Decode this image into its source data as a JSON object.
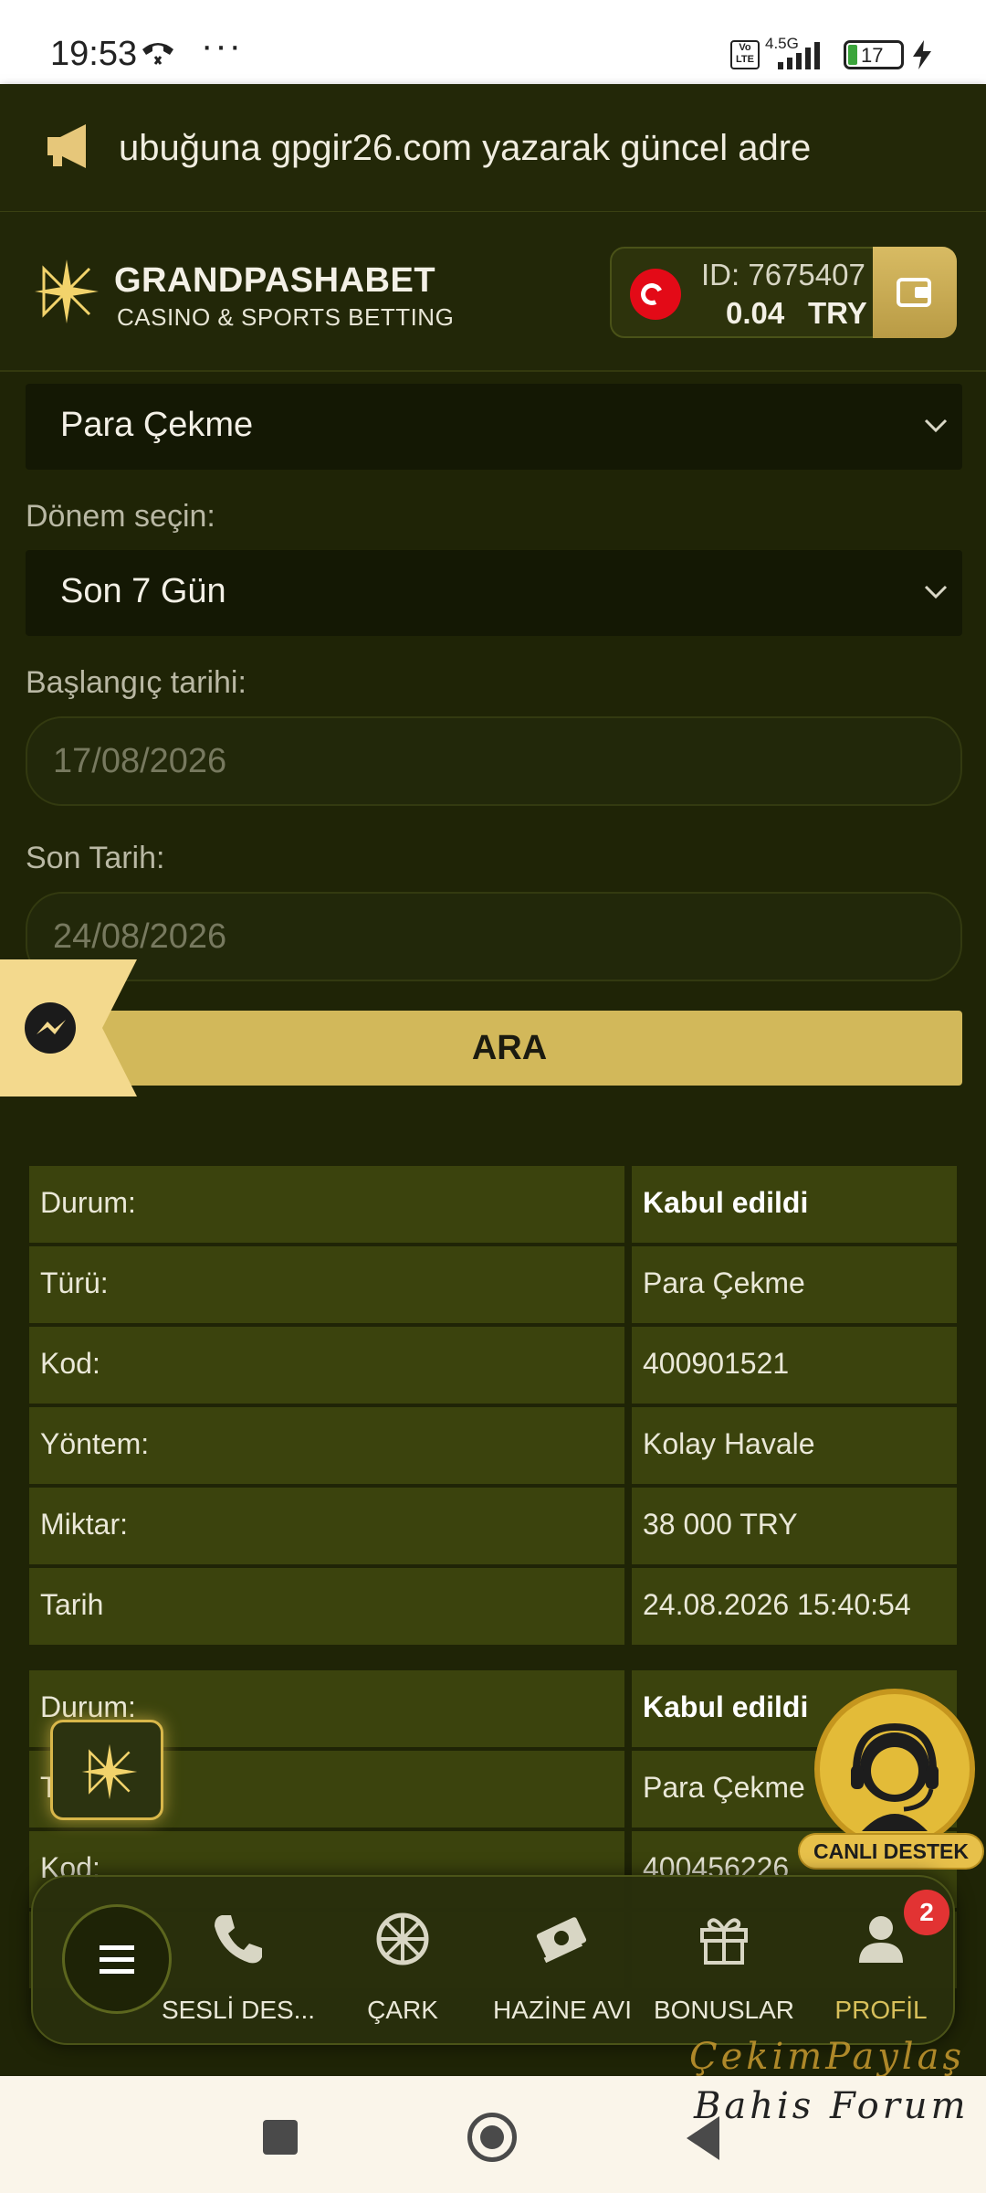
{
  "status_bar": {
    "time": "19:53",
    "more": "···",
    "volte": "Vo LTE",
    "network": "4.5G",
    "battery": "17",
    "icons": [
      "call-icon",
      "signal-icon",
      "battery-icon",
      "charging-icon"
    ]
  },
  "banner": {
    "ticker_text": "ubuğuna gpgir26.com yazarak güncel adre",
    "icon": "megaphone-icon"
  },
  "header": {
    "brand_title": "GRANDPASHABET",
    "brand_subtitle": "CASINO & SPORTS BETTING",
    "account_id": "ID: 7675407",
    "balance": "0.04",
    "currency": "TRY"
  },
  "form": {
    "type_select_value": "Para Çekme",
    "period_label": "Dönem seçin:",
    "period_select_value": "Son 7 Gün",
    "start_label": "Başlangıç tarihi:",
    "start_value": "17/08/2026",
    "end_label": "Son Tarih:",
    "end_value": "24/08/2026",
    "search_button": "ARA"
  },
  "transactions": [
    {
      "rows": [
        {
          "label": "Durum:",
          "value": "Kabul edildi"
        },
        {
          "label": "Türü:",
          "value": "Para Çekme"
        },
        {
          "label": "Kod:",
          "value": "400901521"
        },
        {
          "label": "Yöntem:",
          "value": "Kolay Havale"
        },
        {
          "label": "Miktar:",
          "value": "38 000 TRY"
        },
        {
          "label": "Tarih",
          "value": "24.08.2026 15:40:54"
        }
      ]
    },
    {
      "rows": [
        {
          "label": "Durum:",
          "value": "Kabul edildi"
        },
        {
          "label": "T",
          "value": "Para Çekme"
        },
        {
          "label": "Kod:",
          "value": "400456226"
        }
      ]
    }
  ],
  "live_support": {
    "label": "CANLI DESTEK"
  },
  "bottom_nav": {
    "items": [
      {
        "label": "SESLİ DES...",
        "icon": "phone-icon"
      },
      {
        "label": "ÇARK",
        "icon": "wheel-icon"
      },
      {
        "label": "HAZİNE AVI",
        "icon": "cash-icon"
      },
      {
        "label": "BONUSLAR",
        "icon": "gift-icon"
      },
      {
        "label": "PROFİL",
        "icon": "user-icon",
        "badge": "2"
      }
    ]
  },
  "watermark": {
    "line1": "ÇekimPaylaş",
    "line2": "Bahis Forum"
  },
  "colors": {
    "background": "#1f2406",
    "accent_gold": "#d2b85a",
    "table_cell": "#3b430d",
    "badge_red": "#e23333"
  }
}
